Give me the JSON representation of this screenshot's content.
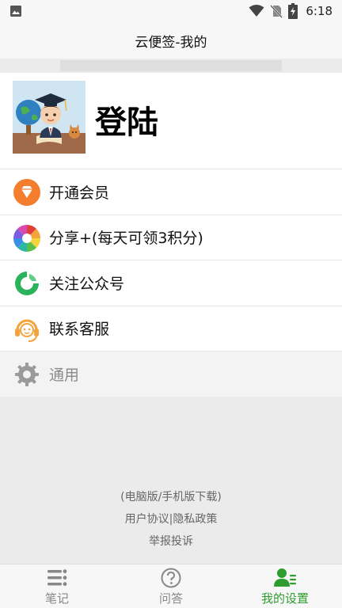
{
  "status_bar": {
    "time": "6:18",
    "icons": [
      "gallery-icon",
      "wifi-icon",
      "no-sim-icon",
      "battery-charging-icon"
    ]
  },
  "header": {
    "title": "云便签-我的"
  },
  "profile": {
    "login_label": "登陆",
    "avatar_icon": "graduate-avatar-illustration"
  },
  "menu": {
    "items": [
      {
        "label": "开通会员",
        "icon": "diamond-icon",
        "color": "#f47d2e"
      },
      {
        "label": "分享+(每天可领3积分)",
        "icon": "share-pinwheel-icon",
        "color": "#e0403a"
      },
      {
        "label": "关注公众号",
        "icon": "wechat-official-icon",
        "color": "#2bb25c"
      },
      {
        "label": "联系客服",
        "icon": "customer-service-icon",
        "color": "#f4a33b"
      },
      {
        "label": "通用",
        "icon": "gear-icon",
        "color": "#9a9a9a"
      }
    ]
  },
  "footer": {
    "download": "(电脑版/手机版下载)",
    "user_agreement": "用户协议",
    "separator": "|",
    "privacy_policy": "隐私政策",
    "report": "举报投诉"
  },
  "tabs": [
    {
      "label": "笔记",
      "icon": "list-icon",
      "active": false
    },
    {
      "label": "问答",
      "icon": "question-icon",
      "active": false
    },
    {
      "label": "我的设置",
      "icon": "user-settings-icon",
      "active": true
    }
  ],
  "colors": {
    "active_tab": "#2e9d2e",
    "inactive_tab": "#888888"
  }
}
